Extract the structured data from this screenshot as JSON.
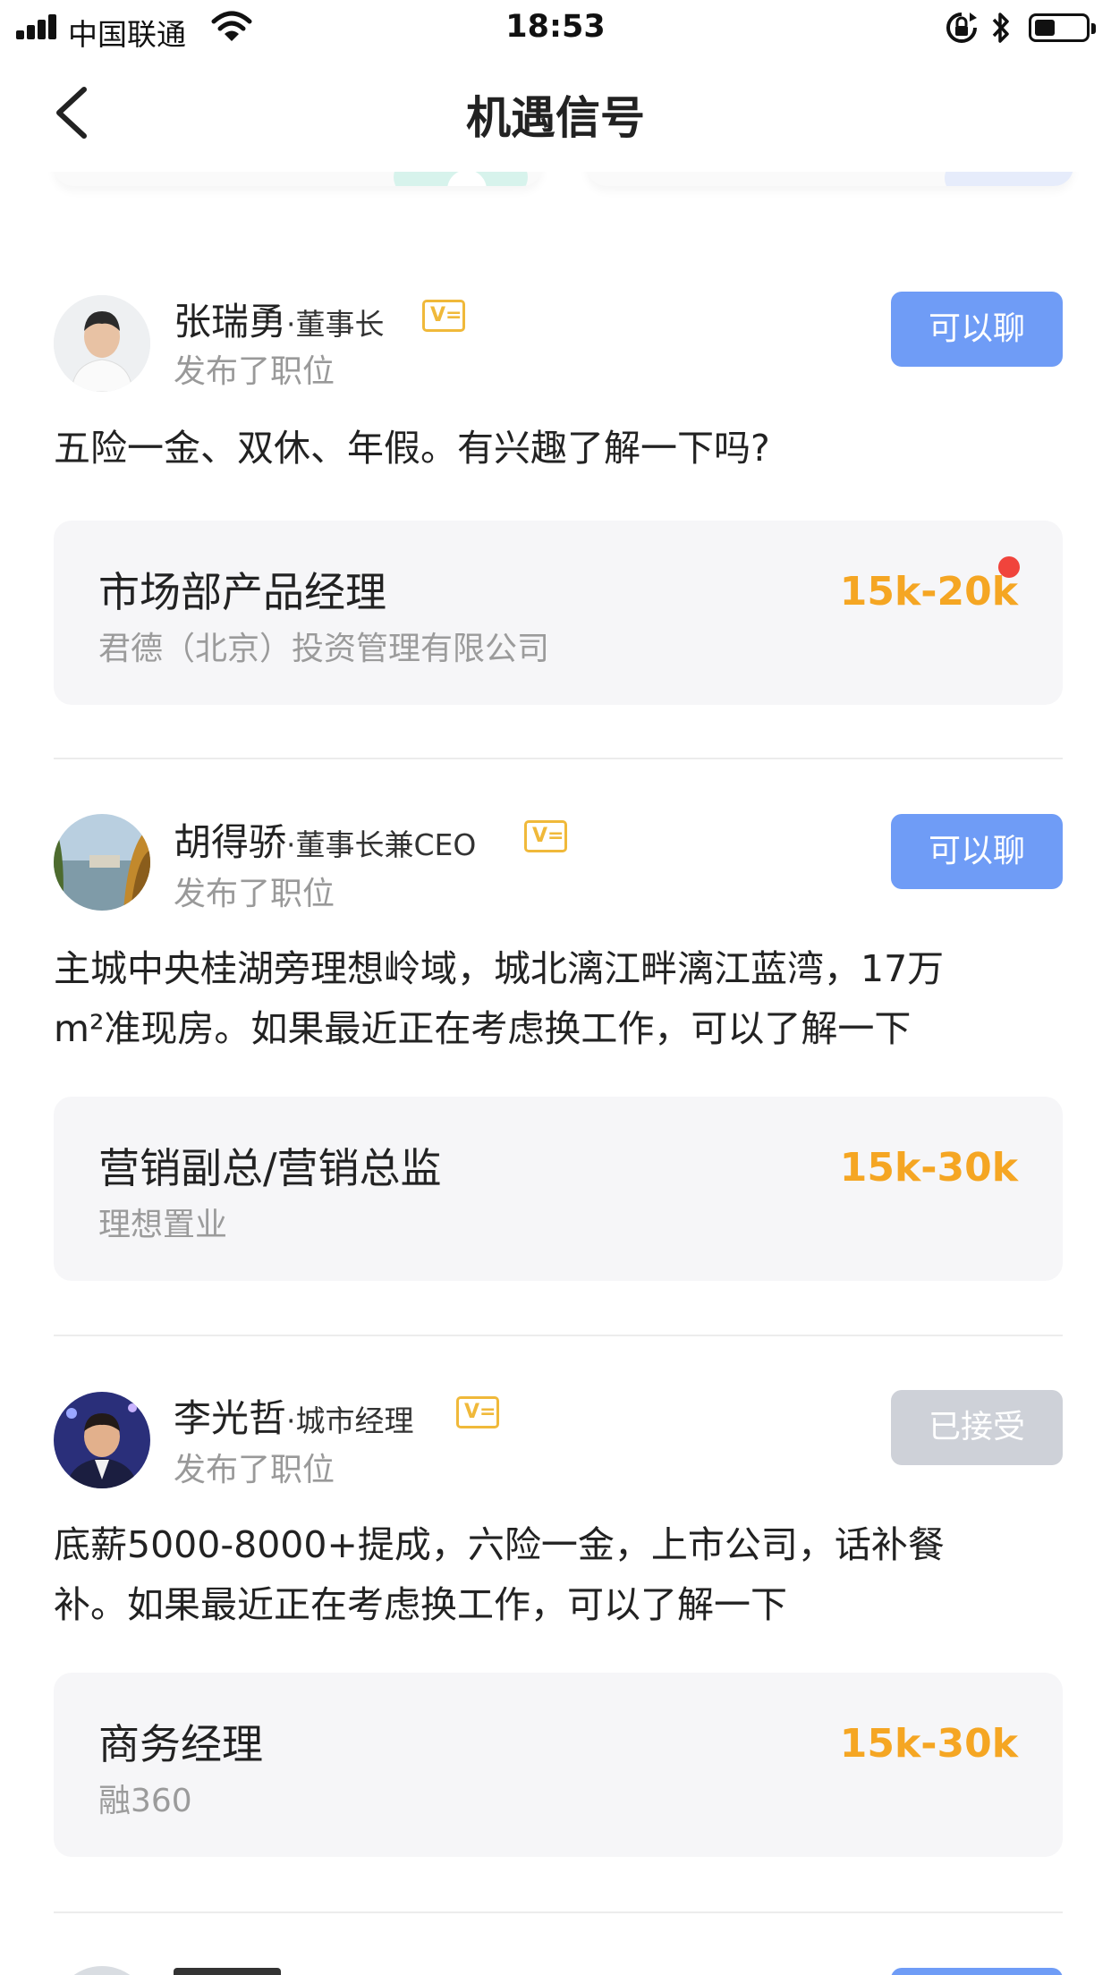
{
  "status_bar": {
    "carrier": "中国联通",
    "time": "18:53",
    "battery_level": 0.4
  },
  "nav": {
    "title": "机遇信号"
  },
  "feed": [
    {
      "name": "张瑞勇",
      "title": "·董事长",
      "verified_badge": "V=",
      "subtitle": "发布了职位",
      "action": "可以聊",
      "action_state": "active",
      "message": "五险一金、双休、年假。有兴趣了解一下吗?",
      "job": {
        "title": "市场部产品经理",
        "company": "君德（北京）投资管理有限公司",
        "salary": "15k-20k",
        "unread": true
      }
    },
    {
      "name": "胡得骄",
      "title": "·董事长兼CEO",
      "verified_badge": "V=",
      "subtitle": "发布了职位",
      "action": "可以聊",
      "action_state": "active",
      "message_line1": "主城中央桂湖旁理想岭域，城北漓江畔漓江蓝湾，17万",
      "message_line2": "m²准现房。如果最近正在考虑换工作，可以了解一下",
      "job": {
        "title": "营销副总/营销总监",
        "company": "理想置业",
        "salary": "15k-30k",
        "unread": false
      }
    },
    {
      "name": "李光哲",
      "title": "·城市经理",
      "verified_badge": "V=",
      "subtitle": "发布了职位",
      "action": "已接受",
      "action_state": "accepted",
      "message_line1": "底薪5000-8000+提成，六险一金，上市公司，话补餐",
      "message_line2": "补。如果最近正在考虑换工作，可以了解一下",
      "job": {
        "title": "商务经理",
        "company": "融360",
        "salary": "15k-30k",
        "unread": false
      }
    }
  ],
  "colors": {
    "accent_blue": "#6f9cf6",
    "accepted_grey": "#ced1d8",
    "salary_orange": "#f5a623",
    "badge_gold": "#f0b93a",
    "unread_red": "#f0443c"
  }
}
